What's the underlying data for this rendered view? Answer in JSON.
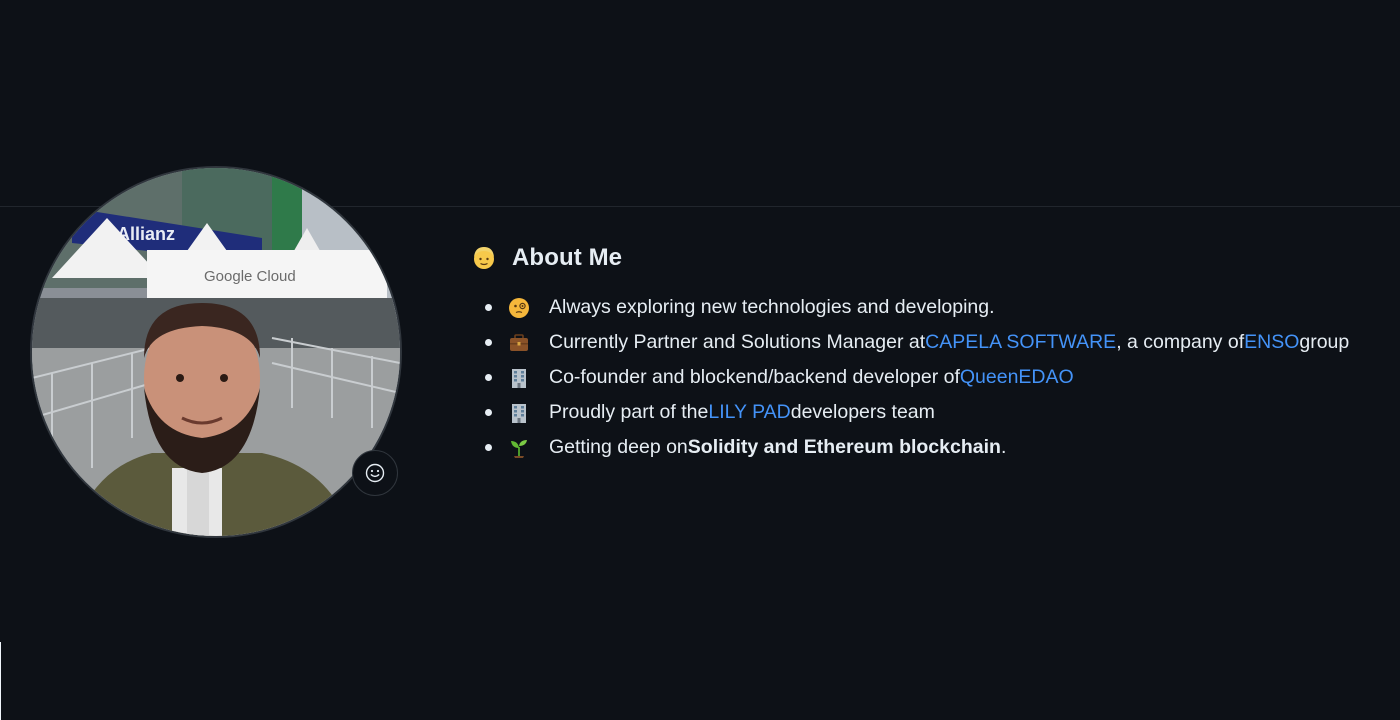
{
  "about": {
    "heading_icon": "person-emoji-icon",
    "title": "About Me",
    "items": [
      {
        "icon": "face-with-monocle-emoji-icon",
        "text": "Always exploring new technologies and developing."
      },
      {
        "icon": "briefcase-emoji-icon",
        "before": "Currently Partner and Solutions Manager at ",
        "link1": "CAPELA SOFTWARE",
        "middle": ", a company of ",
        "link2": "ENSO",
        "after": " group"
      },
      {
        "icon": "office-building-emoji-icon",
        "before": "Co-founder and blockend/backend developer of ",
        "link1": "QueenEDAO"
      },
      {
        "icon": "office-building-emoji-icon",
        "before": "Proudly part of the ",
        "link1": "LILY PAD",
        "after": " developers team"
      },
      {
        "icon": "seedling-emoji-icon",
        "before": "Getting deep on ",
        "bold": "Solidity and Ethereum blockchain",
        "after": "."
      }
    ]
  },
  "avatar": {
    "sign_text": "Google Cloud",
    "banner_text": "Allianz"
  },
  "status_button": {
    "icon": "smiley-icon"
  },
  "colors": {
    "background": "#0d1117",
    "text": "#e6edf3",
    "link": "#4493f8",
    "border": "#30363d"
  }
}
